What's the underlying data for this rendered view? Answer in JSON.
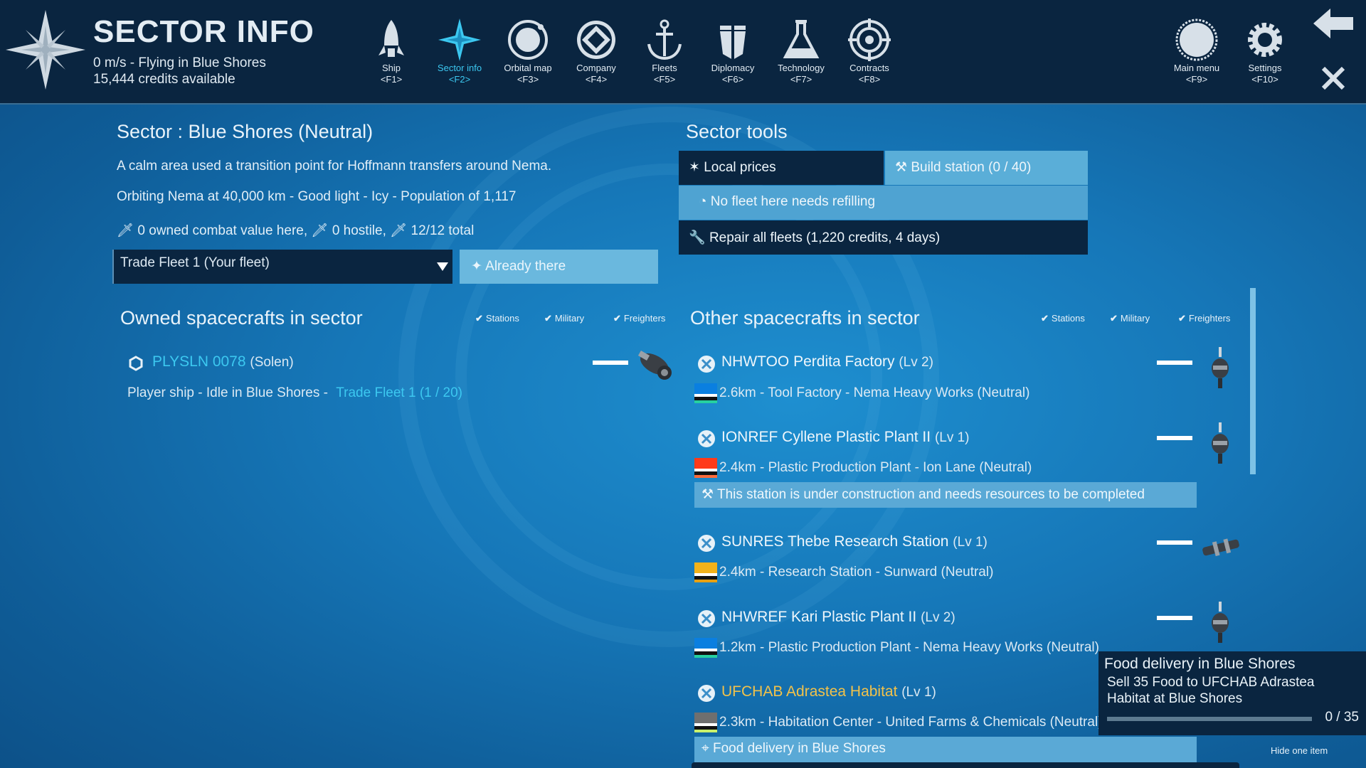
{
  "header": {
    "title": "SECTOR INFO",
    "status_line": "0 m/s - Flying in Blue Shores",
    "credits_line": "15,444 credits available",
    "nav": [
      {
        "label": "Ship",
        "key": "<F1>",
        "icon": "rocket-icon",
        "active": false
      },
      {
        "label": "Sector info",
        "key": "<F2>",
        "icon": "compass-star-icon",
        "active": true
      },
      {
        "label": "Orbital map",
        "key": "<F3>",
        "icon": "orbit-icon",
        "active": false
      },
      {
        "label": "Company",
        "key": "<F4>",
        "icon": "company-emblem-icon",
        "active": false
      },
      {
        "label": "Fleets",
        "key": "<F5>",
        "icon": "anchor-icon",
        "active": false
      },
      {
        "label": "Diplomacy",
        "key": "<F6>",
        "icon": "diplomacy-icon",
        "active": false
      },
      {
        "label": "Technology",
        "key": "<F7>",
        "icon": "flask-icon",
        "active": false
      },
      {
        "label": "Contracts",
        "key": "<F8>",
        "icon": "target-icon",
        "active": false
      },
      {
        "label": "Main menu",
        "key": "<F9>",
        "icon": "menu-circle-icon",
        "active": false
      },
      {
        "label": "Settings",
        "key": "<F10>",
        "icon": "gear-icon",
        "active": false
      }
    ]
  },
  "sector": {
    "heading": "Sector : Blue Shores (Neutral)",
    "description": "A calm area used a transition point for Hoffmann transfers around Nema.",
    "orbit_line": "Orbiting Nema at 40,000 km - Good light - Icy - Population of 1,117",
    "combat_owned": "0  owned combat value here,",
    "combat_hostile": "0  hostile,",
    "combat_total": "12/12  total",
    "fleet_select": "Trade Fleet 1 (Your fleet)",
    "already_there": "Already there"
  },
  "tools": {
    "heading": "Sector tools",
    "local_prices": "Local prices",
    "build_station": "Build station (0 / 40)",
    "refill": "No fleet here needs refilling",
    "repair": "Repair all fleets (1,220 credits, 4 days)"
  },
  "filters": {
    "stations": "Stations",
    "military": "Military",
    "freighters": "Freighters"
  },
  "owned": {
    "heading": "Owned spacecrafts in sector",
    "ship": {
      "name": "PLYSLN 0078",
      "class": "(Solen)",
      "status": "Player ship - Idle in Blue Shores -",
      "fleet_link": "Trade Fleet 1 (1 / 20)"
    }
  },
  "others": {
    "heading": "Other spacecrafts in sector",
    "items": [
      {
        "name": "NHWTOO Perdita Factory",
        "level": "(Lv 2)",
        "detail": "2.6km - Tool Factory - Nema Heavy Works (Neutral)",
        "flag_colors": [
          "#0a7fe0",
          "#ffffff",
          "#111111",
          "#26d0a0"
        ],
        "highlight": false
      },
      {
        "name": "IONREF Cyllene Plastic Plant II",
        "level": "(Lv 1)",
        "detail": "2.4km - Plastic Production Plant - Ion Lane (Neutral)",
        "flag_colors": [
          "#ff3a1a",
          "#ffffff",
          "#111111",
          "#ff6b3a"
        ],
        "highlight": false,
        "banner": "This station is under construction and needs resources to be completed"
      },
      {
        "name": "SUNRES Thebe Research Station",
        "level": "(Lv 1)",
        "detail": "2.4km - Research Station - Sunward (Neutral)",
        "flag_colors": [
          "#f2b21a",
          "#ffffff",
          "#111111",
          "#e8a010"
        ],
        "highlight": false
      },
      {
        "name": "NHWREF Kari Plastic Plant II",
        "level": "(Lv 2)",
        "detail": "1.2km - Plastic Production Plant - Nema Heavy Works (Neutral)",
        "flag_colors": [
          "#0a7fe0",
          "#ffffff",
          "#111111",
          "#26d0a0"
        ],
        "highlight": false
      },
      {
        "name": "UFCHAB Adrastea Habitat",
        "level": "(Lv 1)",
        "detail": "2.3km - Habitation Center - United Farms & Chemicals (Neutral)",
        "flag_colors": [
          "#6f6f6f",
          "#ffffff",
          "#111111",
          "#c8f06a"
        ],
        "highlight": true,
        "banner": "Food delivery in Blue Shores"
      }
    ]
  },
  "tooltip": {
    "title": "Food delivery in Blue Shores",
    "description": "Sell 35 Food to UFCHAB Adrastea Habitat at Blue Shores",
    "progress": "0 / 35",
    "progress_fraction": 0,
    "hide_label": "Hide one item"
  },
  "colors": {
    "accent": "#3cc8f0",
    "gold": "#f2c24a",
    "panel_dark": "#0a2540",
    "button_light": "#5aaed8"
  }
}
